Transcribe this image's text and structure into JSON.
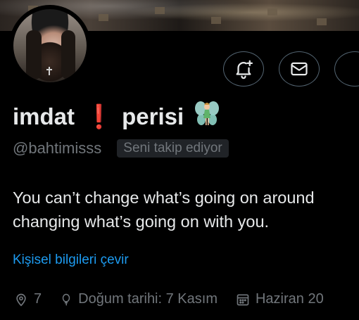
{
  "profile": {
    "name_part1": "imdat",
    "exclaim": "❗",
    "name_part2": "perisi",
    "name_emoji": "fairy-emoji",
    "handle": "@bahtimisss",
    "follows_badge": "Seni takip ediyor",
    "bio_line1": "You can’t change what’s going on around",
    "bio_line2": "changing what’s going on with you.",
    "translate_link": "Kişisel bilgileri çevir"
  },
  "meta": {
    "location": "7",
    "birthday": "Doğum tarihi: 7 Kasım",
    "joined": "Haziran 20"
  },
  "actions": {
    "bell_icon": "notification-bell-plus-icon",
    "mail_icon": "envelope-icon",
    "more_icon": "more-icon"
  },
  "colors": {
    "background": "#000000",
    "text": "#e7e9ea",
    "secondary": "#71767b",
    "link": "#1d9bf0",
    "exclaim": "#e0102a",
    "border": "#536471"
  }
}
